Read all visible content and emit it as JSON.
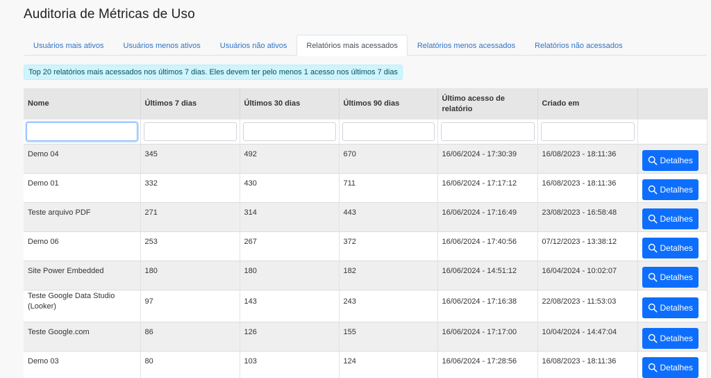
{
  "page": {
    "title": "Auditoria de Métricas de Uso"
  },
  "tabs": [
    {
      "label": "Usuários mais ativos",
      "active": false
    },
    {
      "label": "Usuários menos ativos",
      "active": false
    },
    {
      "label": "Usuários não ativos",
      "active": false
    },
    {
      "label": "Relatórios mais acessados",
      "active": true
    },
    {
      "label": "Relatórios menos acessados",
      "active": false
    },
    {
      "label": "Relatórios não acessados",
      "active": false
    }
  ],
  "info": {
    "text": "Top 20 relatórios mais acessados nos últimos 7 dias. Eles devem ter pelo menos 1 acesso nos últimos 7 dias"
  },
  "table": {
    "columns": [
      "Nome",
      "Últimos 7 dias",
      "Últimos 30 dias",
      "Últimos 90 dias",
      "Último acesso de relatório",
      "Criado em",
      ""
    ],
    "filters": [
      "",
      "",
      "",
      "",
      "",
      ""
    ],
    "button_label": "Detalhes",
    "rows": [
      {
        "nome": "Demo 04",
        "d7": "345",
        "d30": "492",
        "d90": "670",
        "ultimo": "16/06/2024 - 17:30:39",
        "criado": "16/08/2023 - 18:11:36"
      },
      {
        "nome": "Demo 01",
        "d7": "332",
        "d30": "430",
        "d90": "711",
        "ultimo": "16/06/2024 - 17:17:12",
        "criado": "16/08/2023 - 18:11:36"
      },
      {
        "nome": "Teste arquivo PDF",
        "d7": "271",
        "d30": "314",
        "d90": "443",
        "ultimo": "16/06/2024 - 17:16:49",
        "criado": "23/08/2023 - 16:58:48"
      },
      {
        "nome": "Demo 06",
        "d7": "253",
        "d30": "267",
        "d90": "372",
        "ultimo": "16/06/2024 - 17:40:56",
        "criado": "07/12/2023 - 13:38:12"
      },
      {
        "nome": "Site Power Embedded",
        "d7": "180",
        "d30": "180",
        "d90": "182",
        "ultimo": "16/06/2024 - 14:51:12",
        "criado": "16/04/2024 - 10:02:07"
      },
      {
        "nome": "Teste Google Data Studio (Looker)",
        "d7": "97",
        "d30": "143",
        "d90": "243",
        "ultimo": "16/06/2024 - 17:16:38",
        "criado": "22/08/2023 - 11:53:03"
      },
      {
        "nome": "Teste Google.com",
        "d7": "86",
        "d30": "126",
        "d90": "155",
        "ultimo": "16/06/2024 - 17:17:00",
        "criado": "10/04/2024 - 14:47:04"
      },
      {
        "nome": "Demo 03",
        "d7": "80",
        "d30": "103",
        "d90": "124",
        "ultimo": "16/06/2024 - 17:28:56",
        "criado": "16/08/2023 - 18:11:36"
      }
    ]
  },
  "colors": {
    "accent": "#0d6efd",
    "tab_link": "#2f73c7",
    "info_bg": "#cff4fc"
  },
  "icons": {
    "button_icon": "search-icon"
  }
}
